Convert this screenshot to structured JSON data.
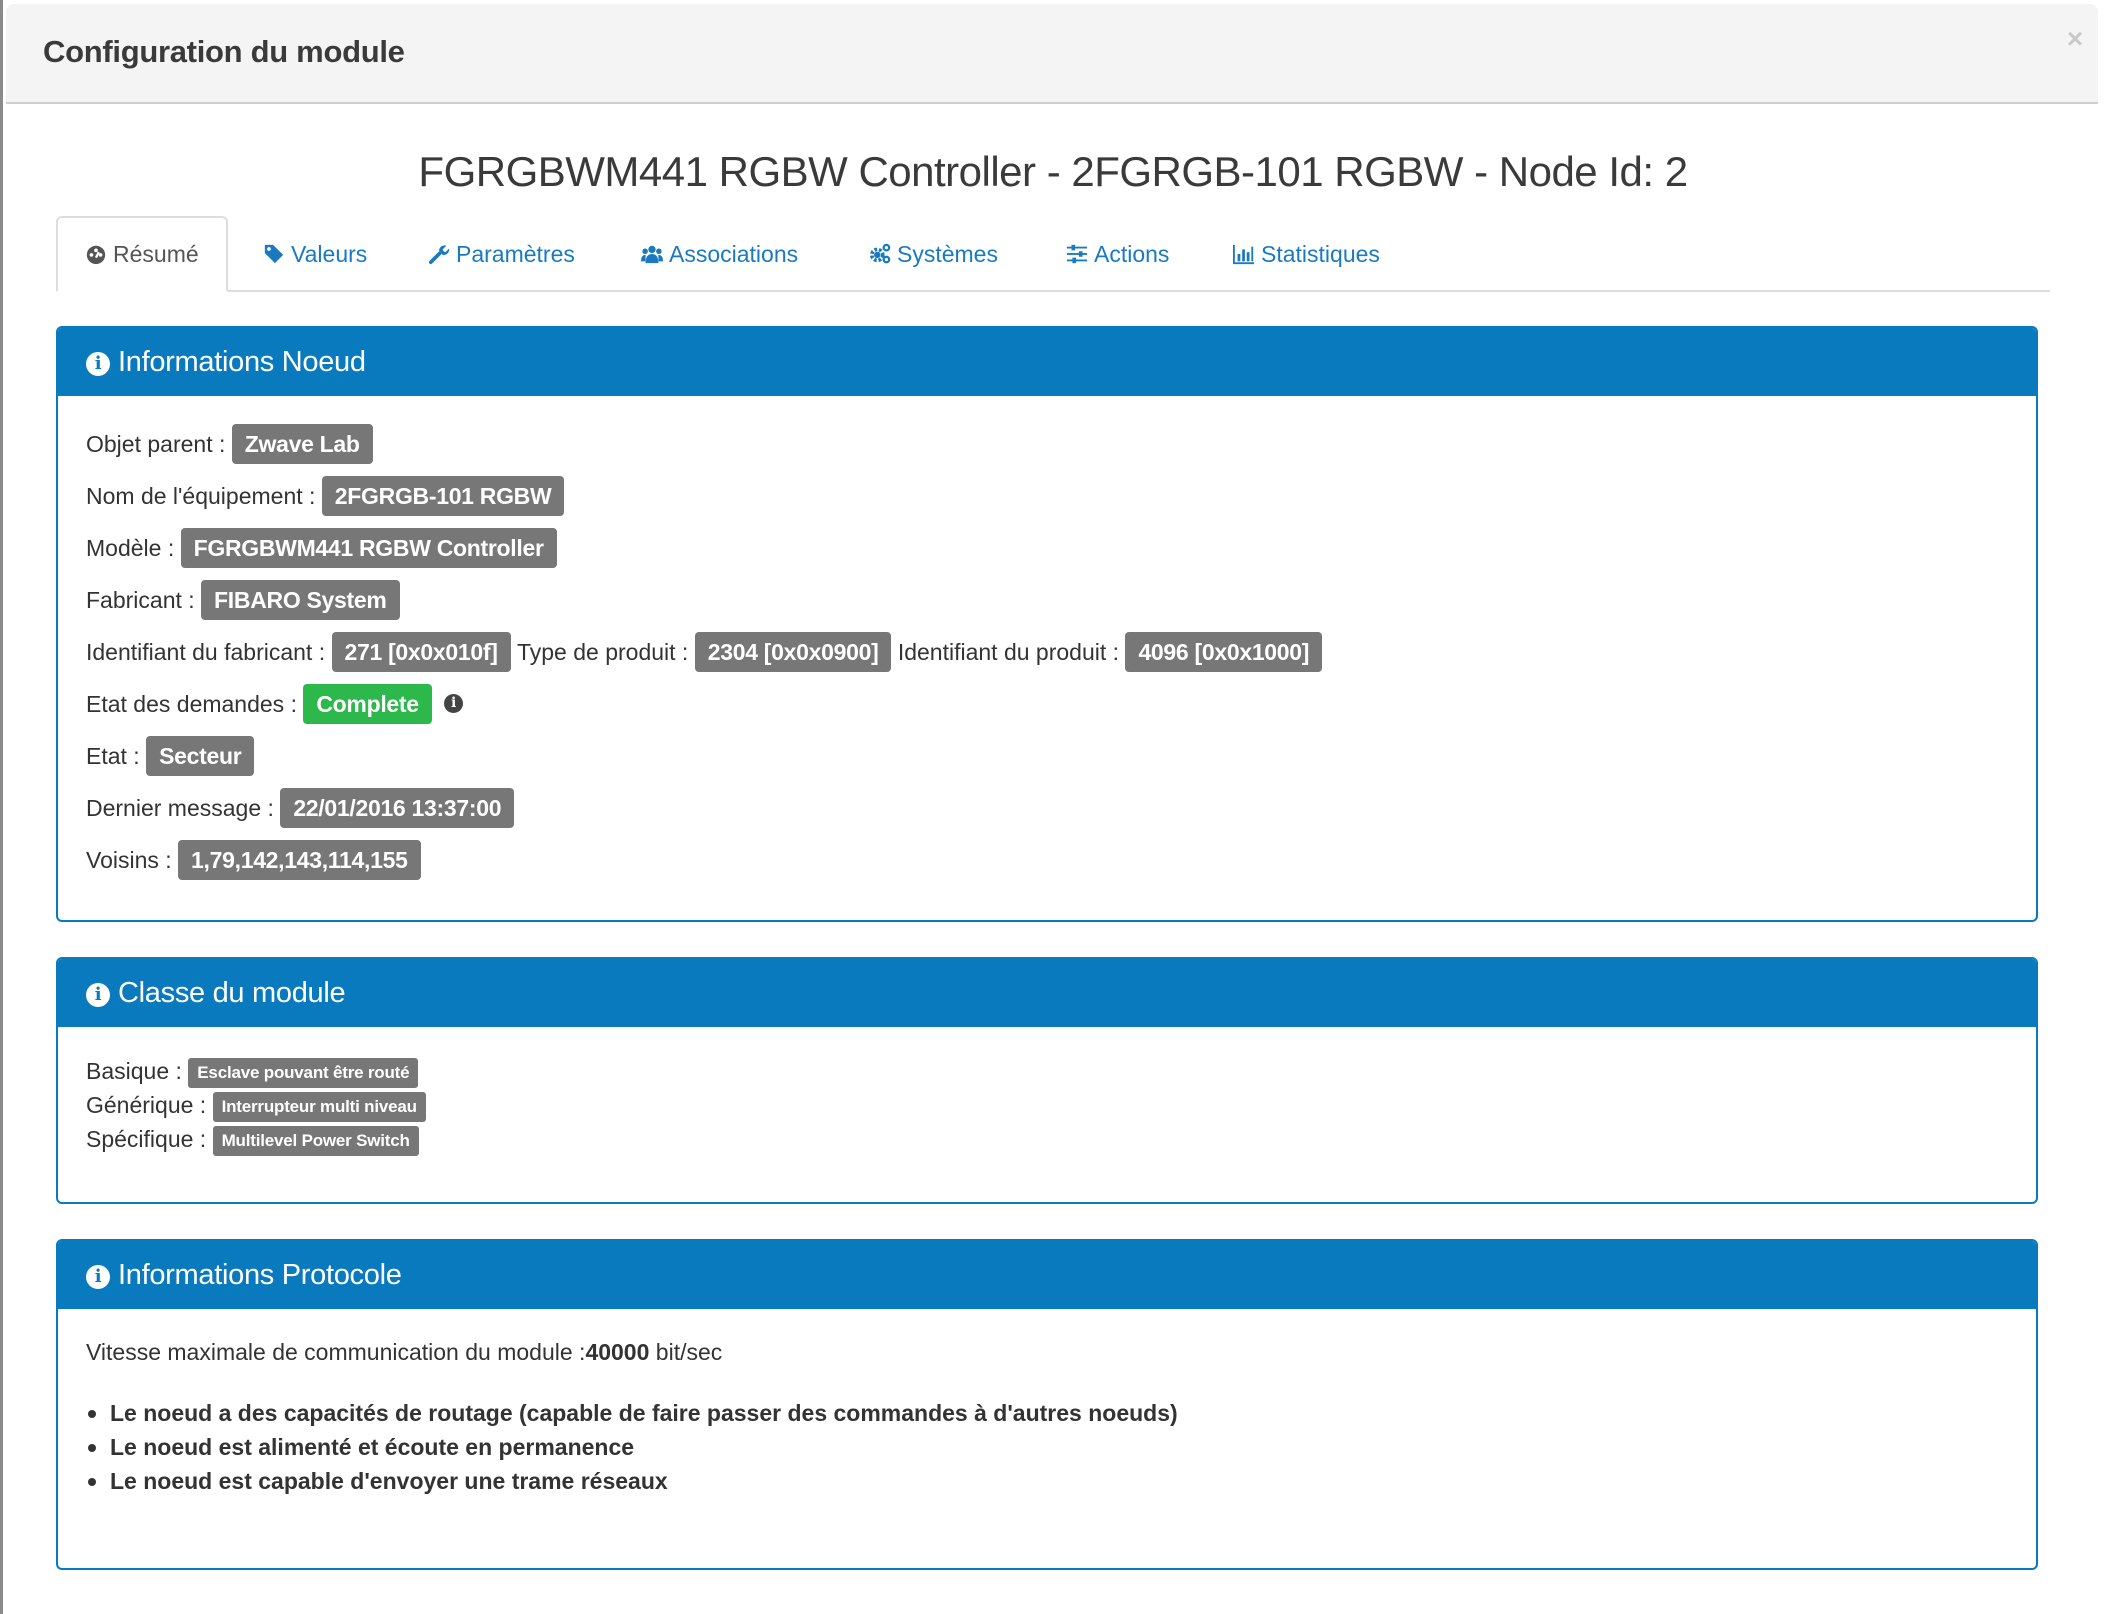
{
  "modal": {
    "title": "Configuration du module",
    "close_label": "×"
  },
  "node_title": "FGRGBWM441 RGBW Controller - 2FGRGB-101 RGBW - Node Id: 2",
  "tabs": [
    {
      "label": "Résumé",
      "icon": "dashboard-icon",
      "active": true
    },
    {
      "label": "Valeurs",
      "icon": "tag-icon",
      "active": false
    },
    {
      "label": "Paramètres",
      "icon": "wrench-icon",
      "active": false
    },
    {
      "label": "Associations",
      "icon": "users-icon",
      "active": false
    },
    {
      "label": "Systèmes",
      "icon": "cogs-icon",
      "active": false
    },
    {
      "label": "Actions",
      "icon": "sliders-icon",
      "active": false
    },
    {
      "label": "Statistiques",
      "icon": "bar-chart-icon",
      "active": false
    }
  ],
  "colors": {
    "primary": "#0a7abf",
    "badge_default": "#777777",
    "badge_success": "#2db84b",
    "link": "#1a7ac0"
  },
  "node_info": {
    "title": "Informations Noeud",
    "rows": {
      "parent_label": "Objet parent :",
      "parent_value": "Zwave Lab",
      "equipment_label": "Nom de l'équipement :",
      "equipment_value": "2FGRGB-101 RGBW",
      "model_label": "Modèle :",
      "model_value": "FGRGBWM441 RGBW Controller",
      "manufacturer_label": "Fabricant :",
      "manufacturer_value": "FIBARO System",
      "manufacturer_id_label": "Identifiant du fabricant :",
      "manufacturer_id_value": "271 [0x0x010f]",
      "product_type_label": "Type de produit :",
      "product_type_value": "2304 [0x0x0900]",
      "product_id_label": "Identifiant du produit :",
      "product_id_value": "4096 [0x0x1000]",
      "query_state_label": "Etat des demandes :",
      "query_state_value": "Complete",
      "state_label": "Etat :",
      "state_value": "Secteur",
      "last_message_label": "Dernier message :",
      "last_message_value": "22/01/2016 13:37:00",
      "neighbors_label": "Voisins :",
      "neighbors_value": "1,79,142,143,114,155"
    }
  },
  "module_class": {
    "title": "Classe du module",
    "basic_label": "Basique :",
    "basic_value": "Esclave pouvant être routé",
    "generic_label": "Générique :",
    "generic_value": "Interrupteur multi niveau",
    "specific_label": "Spécifique :",
    "specific_value": "Multilevel Power Switch"
  },
  "protocol_info": {
    "title": "Informations Protocole",
    "speed_prefix": "Vitesse maximale de communication du module :",
    "speed_value": "40000",
    "speed_unit": " bit/sec",
    "capabilities": [
      "Le noeud a des capacités de routage (capable de faire passer des commandes à d'autres noeuds)",
      "Le noeud est alimenté et écoute en permanence",
      "Le noeud est capable d'envoyer une trame réseaux"
    ]
  }
}
